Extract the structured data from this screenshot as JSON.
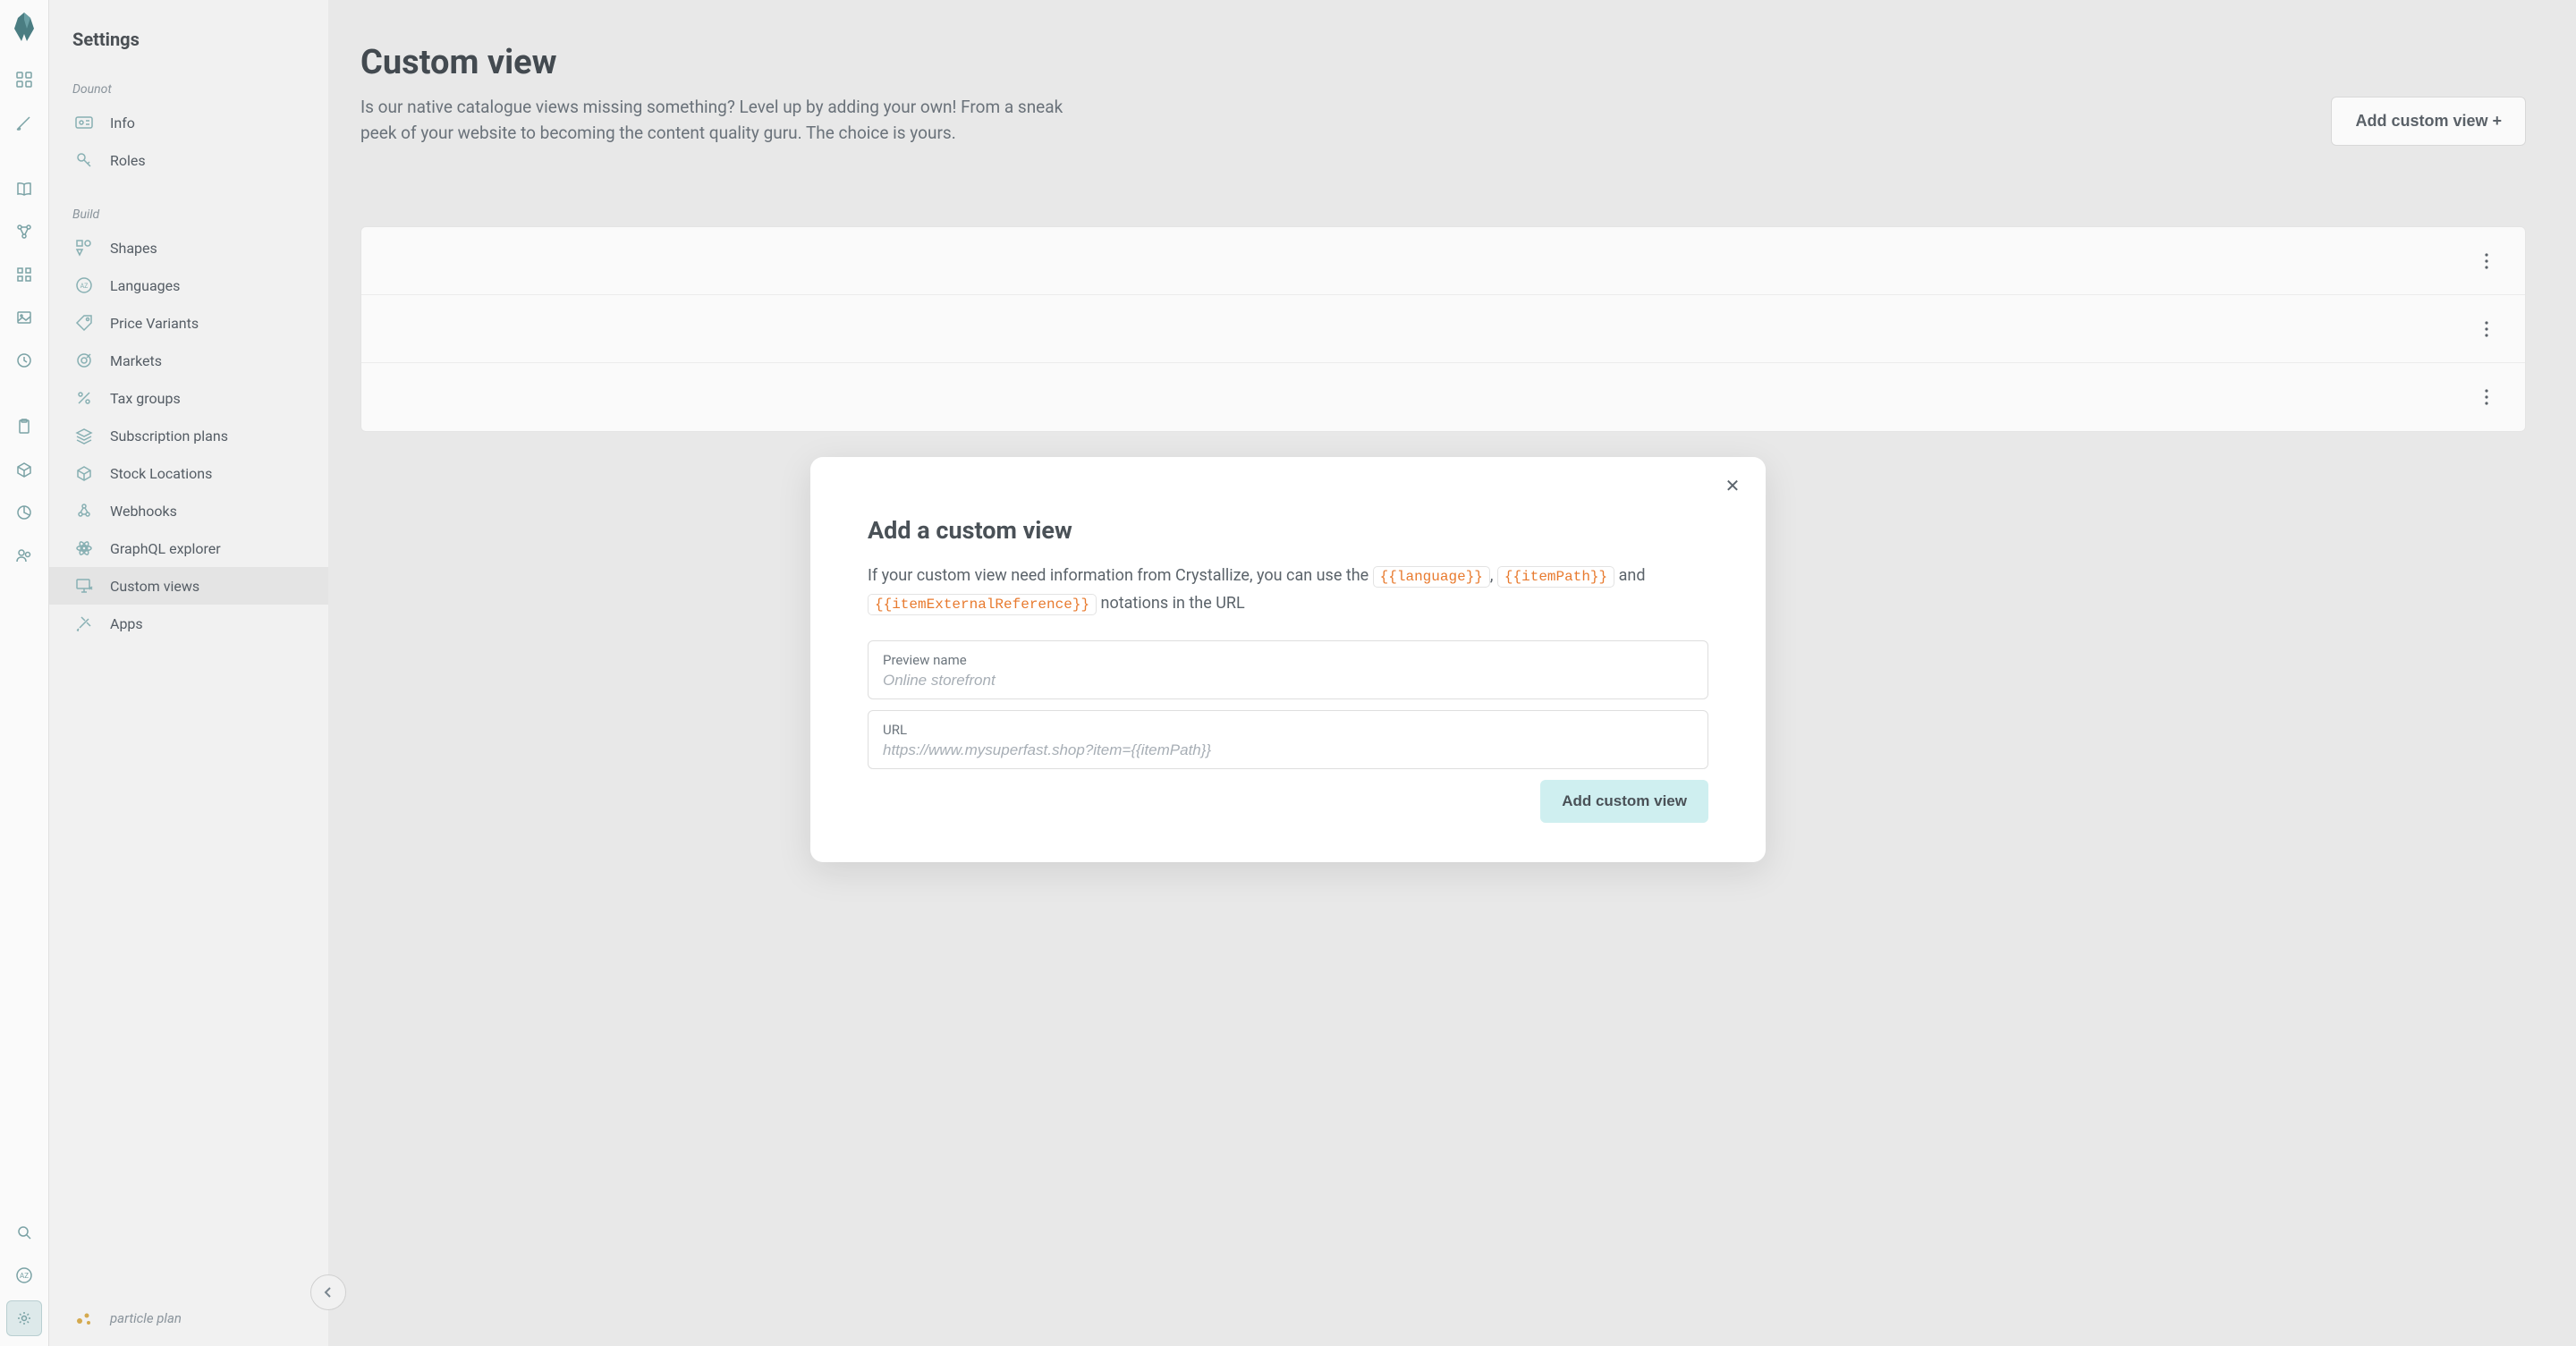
{
  "rail": {
    "items": [
      {
        "name": "dashboard-icon"
      },
      {
        "name": "brush-icon"
      },
      {
        "name": "book-icon"
      },
      {
        "name": "nodes-icon"
      },
      {
        "name": "grid-icon"
      },
      {
        "name": "image-icon"
      },
      {
        "name": "badge-icon"
      },
      {
        "name": "clipboard-icon"
      },
      {
        "name": "box-icon"
      },
      {
        "name": "pie-icon"
      },
      {
        "name": "users-icon"
      },
      {
        "name": "search-icon"
      },
      {
        "name": "translate-icon"
      },
      {
        "name": "gear-icon"
      }
    ]
  },
  "sidebar": {
    "title": "Settings",
    "sections": [
      {
        "label": "Dounot",
        "items": [
          {
            "icon": "id-card-icon",
            "label": "Info"
          },
          {
            "icon": "key-icon",
            "label": "Roles"
          }
        ]
      },
      {
        "label": "Build",
        "items": [
          {
            "icon": "shapes-icon",
            "label": "Shapes"
          },
          {
            "icon": "az-icon",
            "label": "Languages"
          },
          {
            "icon": "tag-icon",
            "label": "Price Variants"
          },
          {
            "icon": "target-icon",
            "label": "Markets"
          },
          {
            "icon": "percent-icon",
            "label": "Tax groups"
          },
          {
            "icon": "layers-icon",
            "label": "Subscription plans"
          },
          {
            "icon": "cube-icon",
            "label": "Stock Locations"
          },
          {
            "icon": "hook-icon",
            "label": "Webhooks"
          },
          {
            "icon": "atom-icon",
            "label": "GraphQL explorer"
          },
          {
            "icon": "monitor-icon",
            "label": "Custom views",
            "active": true
          },
          {
            "icon": "plug-icon",
            "label": "Apps"
          }
        ]
      }
    ],
    "plan": "particle plan"
  },
  "main": {
    "title": "Custom view",
    "description": "Is our native catalogue views missing something? Level up by adding your own! From a sneak peek of your website to becoming the content quality guru. The choice is yours.",
    "add_button": "Add custom view +",
    "rows": 3
  },
  "modal": {
    "title": "Add a custom view",
    "desc_before": "If your custom view need information from Crystallize, you can use the ",
    "token1": "{{language}}",
    "comma": ", ",
    "token2": "{{itemPath}}",
    "and": " and ",
    "token3": "{{itemExternalReference}}",
    "desc_after": " notations in the URL",
    "field1_label": "Preview name",
    "field1_placeholder": "Online storefront",
    "field2_label": "URL",
    "field2_placeholder": "https://www.mysuperfast.shop?item={{itemPath}}",
    "submit": "Add custom view"
  }
}
